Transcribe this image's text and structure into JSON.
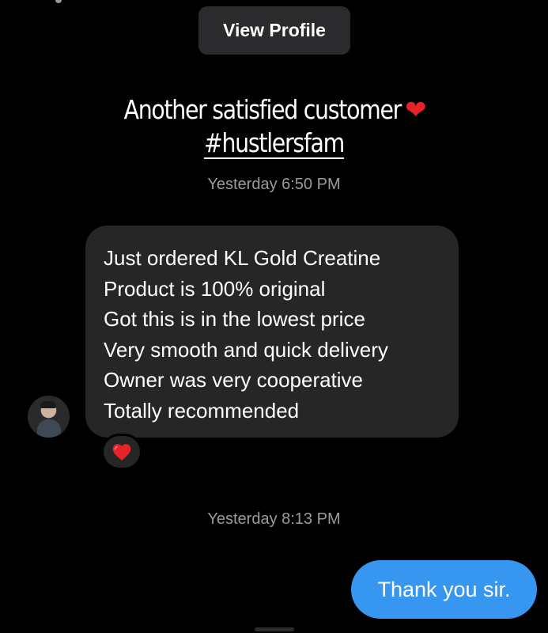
{
  "header": {
    "view_profile_label": "View Profile"
  },
  "story": {
    "caption_line1": "Another satisfied customer",
    "heart_glyph": "❤",
    "caption_line2": "#hustlersfam"
  },
  "timestamps": {
    "first": "Yesterday 6:50 PM",
    "second": "Yesterday 8:13 PM"
  },
  "incoming_message": {
    "lines": [
      "Just ordered KL Gold Creatine",
      "Product is 100% original",
      "Got this is in the lowest price",
      "Very smooth and quick delivery",
      "Owner was very cooperative",
      "Totally recommended"
    ],
    "reaction": "heart"
  },
  "outgoing_message": {
    "text": "Thank you sir."
  },
  "colors": {
    "background": "#000000",
    "incoming_bubble": "#262626",
    "outgoing_bubble": "#3797f0",
    "view_profile_button": "#2b2b2d",
    "timestamp_text": "#9b9b9f",
    "heart": "#e8222a"
  },
  "icons": {
    "reaction": "heart-icon",
    "caption_emoji": "red-heart-icon",
    "avatar": "user-avatar"
  }
}
